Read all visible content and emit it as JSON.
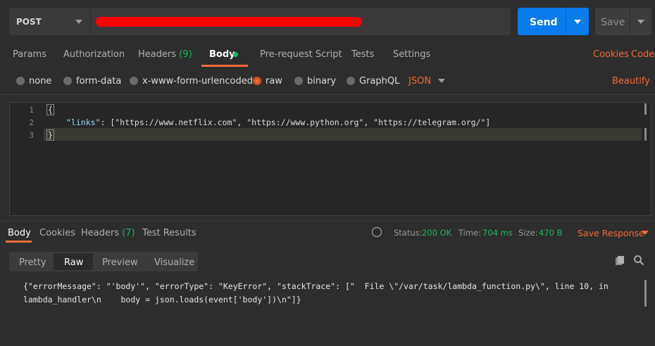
{
  "request": {
    "method": "POST",
    "send_label": "Send",
    "save_label": "Save"
  },
  "tabs": {
    "params": "Params",
    "authorization": "Authorization",
    "headers": "Headers",
    "headers_count": "(9)",
    "body": "Body",
    "prerequest": "Pre-request Script",
    "tests": "Tests",
    "settings": "Settings",
    "cookies": "Cookies",
    "code": "Code"
  },
  "body_types": {
    "none": "none",
    "form_data": "form-data",
    "urlencoded": "x-www-form-urlencoded",
    "raw": "raw",
    "binary": "binary",
    "graphql": "GraphQL",
    "format": "JSON",
    "beautify": "Beautify"
  },
  "editor": {
    "line_numbers": [
      "1",
      "2",
      "3"
    ],
    "line1": "{",
    "line2_key": "\"links\"",
    "line2_rest": ": [\"https://www.netflix.com\", \"https://www.python.org\", \"https://telegram.org/\"]",
    "line3": "}"
  },
  "response": {
    "tabs": {
      "body": "Body",
      "cookies": "Cookies",
      "headers": "Headers",
      "headers_count": "(7)",
      "test_results": "Test Results"
    },
    "status_label": "Status:",
    "status_value": "200 OK",
    "time_label": "Time:",
    "time_value": "704 ms",
    "size_label": "Size:",
    "size_value": "470 B",
    "save_response": "Save Response",
    "views": {
      "pretty": "Pretty",
      "raw": "Raw",
      "preview": "Preview",
      "visualize": "Visualize"
    },
    "body_line1": "{\"errorMessage\": \"'body'\", \"errorType\": \"KeyError\", \"stackTrace\": [\"  File \\\"/var/task/lambda_function.py\\\", line 10, in",
    "body_line2": "lambda_handler\\n    body = json.loads(event['body'])\\n\"]}"
  },
  "colors": {
    "accent": "#f26b3a",
    "send": "#097bed",
    "success": "#1fb85e",
    "background": "#2d2d2d"
  }
}
